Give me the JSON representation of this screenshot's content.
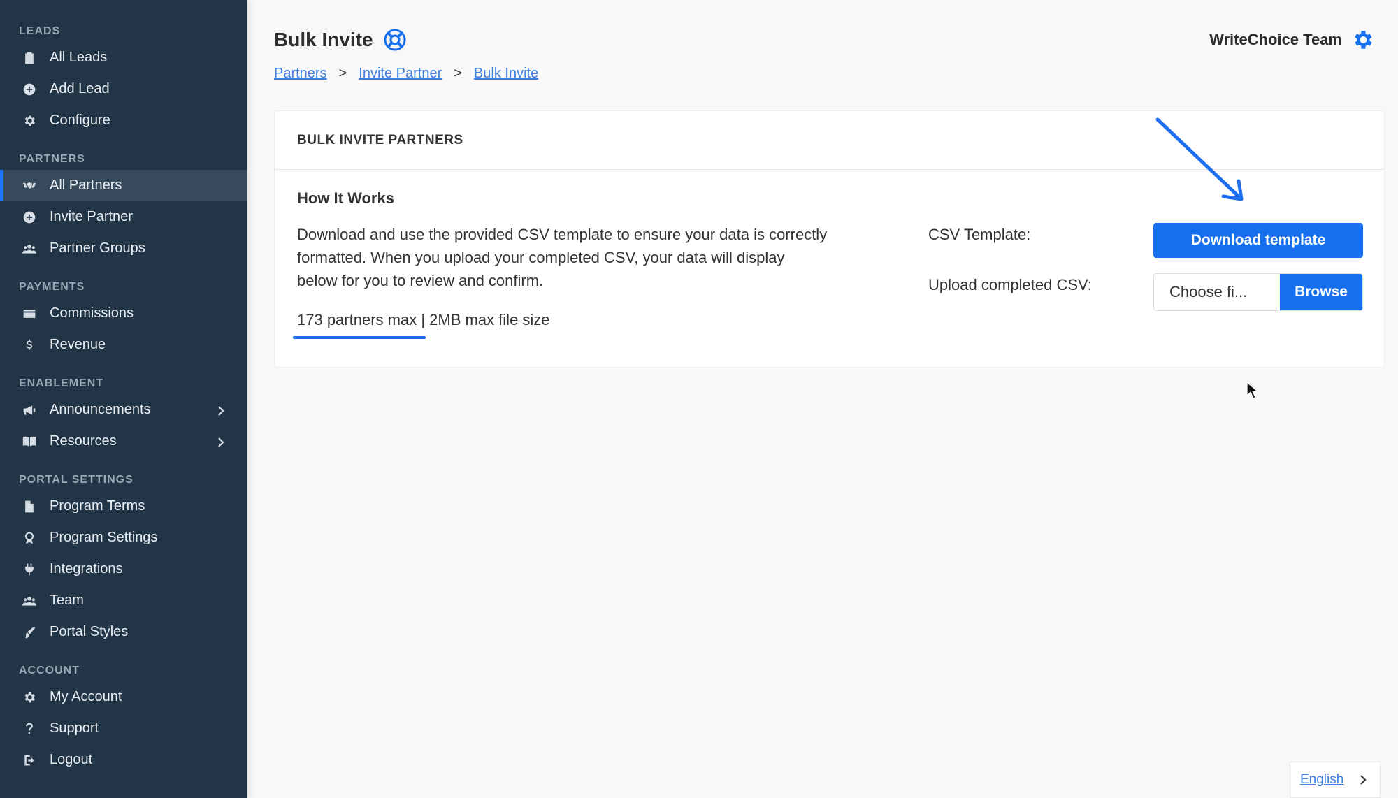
{
  "sidebar": {
    "sections": [
      {
        "header": "LEADS",
        "items": [
          {
            "label": "All Leads",
            "icon": "clipboard-icon"
          },
          {
            "label": "Add Lead",
            "icon": "plus-circle-icon"
          },
          {
            "label": "Configure",
            "icon": "gear-icon"
          }
        ]
      },
      {
        "header": "PARTNERS",
        "items": [
          {
            "label": "All Partners",
            "icon": "handshake-icon",
            "active": true
          },
          {
            "label": "Invite Partner",
            "icon": "plus-circle-icon"
          },
          {
            "label": "Partner Groups",
            "icon": "users-icon"
          }
        ]
      },
      {
        "header": "PAYMENTS",
        "items": [
          {
            "label": "Commissions",
            "icon": "credit-card-icon"
          },
          {
            "label": "Revenue",
            "icon": "dollar-icon"
          }
        ]
      },
      {
        "header": "ENABLEMENT",
        "items": [
          {
            "label": "Announcements",
            "icon": "megaphone-icon",
            "chevron": true
          },
          {
            "label": "Resources",
            "icon": "book-icon",
            "chevron": true
          }
        ]
      },
      {
        "header": "PORTAL SETTINGS",
        "items": [
          {
            "label": "Program Terms",
            "icon": "file-icon"
          },
          {
            "label": "Program Settings",
            "icon": "award-icon"
          },
          {
            "label": "Integrations",
            "icon": "plug-icon"
          },
          {
            "label": "Team",
            "icon": "users-icon"
          },
          {
            "label": "Portal Styles",
            "icon": "brush-icon"
          }
        ]
      },
      {
        "header": "ACCOUNT",
        "items": [
          {
            "label": "My Account",
            "icon": "gear-icon"
          },
          {
            "label": "Support",
            "icon": "question-icon"
          },
          {
            "label": "Logout",
            "icon": "logout-icon"
          }
        ]
      }
    ]
  },
  "header": {
    "title": "Bulk Invite",
    "team_name": "WriteChoice Team"
  },
  "breadcrumb": {
    "items": [
      "Partners",
      "Invite Partner",
      "Bulk Invite"
    ],
    "separator": ">"
  },
  "card": {
    "title": "BULK INVITE PARTNERS",
    "how_title": "How It Works",
    "description": "Download and use the provided CSV template to ensure your data is correctly formatted. When you upload your completed CSV, your data will display below for you to review and confirm.",
    "limits_partners": "173 partners max",
    "limits_sep": " | ",
    "limits_size": "2MB max file size",
    "csv_template_label": "CSV Template:",
    "upload_label": "Upload completed CSV:",
    "download_button": "Download template",
    "file_placeholder": "Choose fi...",
    "browse_button": "Browse"
  },
  "footer": {
    "language": "English"
  },
  "colors": {
    "sidebar_bg": "#213547",
    "accent": "#1670ee",
    "link": "#3f7fe0"
  }
}
